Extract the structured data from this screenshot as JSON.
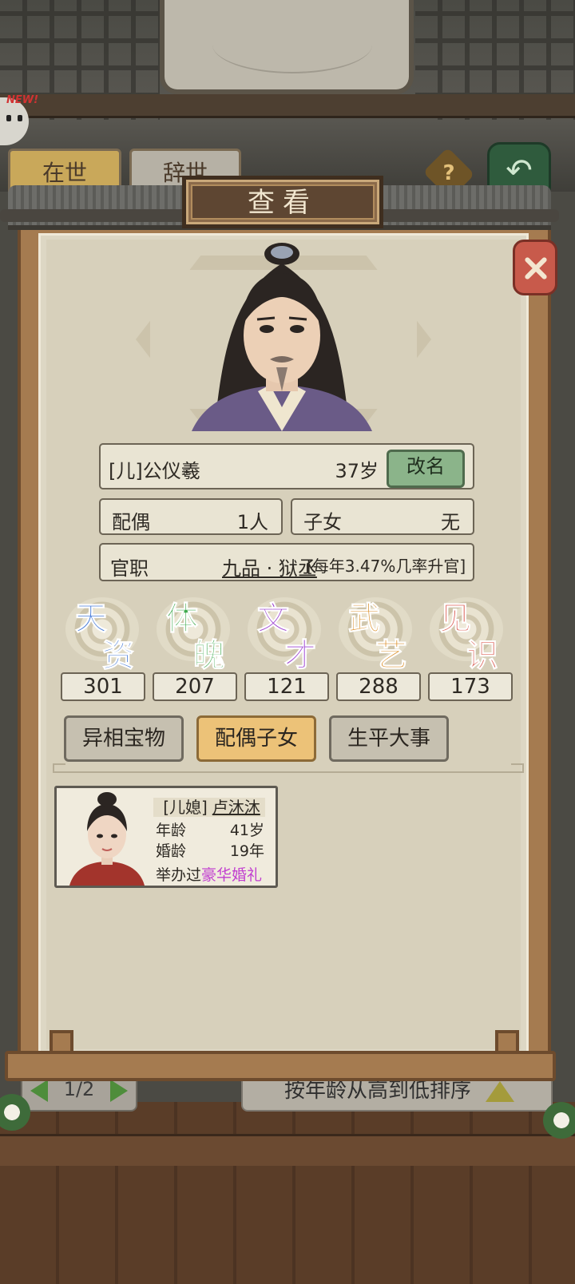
{
  "background": {
    "tabs": [
      "在世",
      "辞世"
    ],
    "help_icon": "?",
    "back_icon": "↶",
    "new_badge": "NEW!",
    "pager": "1/2",
    "sort_label": "按年龄从高到低排序"
  },
  "panel": {
    "title": "查看",
    "close_icon": "close-icon"
  },
  "person": {
    "name": "[儿]公仪羲",
    "age": "37岁",
    "rename_label": "改名",
    "spouse_label": "配偶",
    "spouse_value": "1人",
    "children_label": "子女",
    "children_value": "无",
    "office_label": "官职",
    "office_rank": "九品 · 狱丞",
    "office_rate": "[每年3.47%几率升官]"
  },
  "attributes": [
    {
      "c1": "天",
      "c2": "资",
      "value": "301",
      "color": "#3d74d6"
    },
    {
      "c1": "体",
      "c2": "魄",
      "value": "207",
      "color": "#3faa4e"
    },
    {
      "c1": "文",
      "c2": "才",
      "value": "121",
      "color": "#9b3fd0"
    },
    {
      "c1": "武",
      "c2": "艺",
      "value": "288",
      "color": "#d98a1f"
    },
    {
      "c1": "见",
      "c2": "识",
      "value": "173",
      "color": "#d9544a"
    }
  ],
  "tabs": [
    "异相宝物",
    "配偶子女",
    "生平大事"
  ],
  "active_tab": 1,
  "spouse_card": {
    "prefix": "[儿媳]",
    "name": "卢沐沐",
    "age_label": "年龄",
    "age_value": "41岁",
    "marriage_label": "婚龄",
    "marriage_value": "19年",
    "wedding_prefix": "举办过",
    "wedding_type": "豪华婚礼"
  }
}
